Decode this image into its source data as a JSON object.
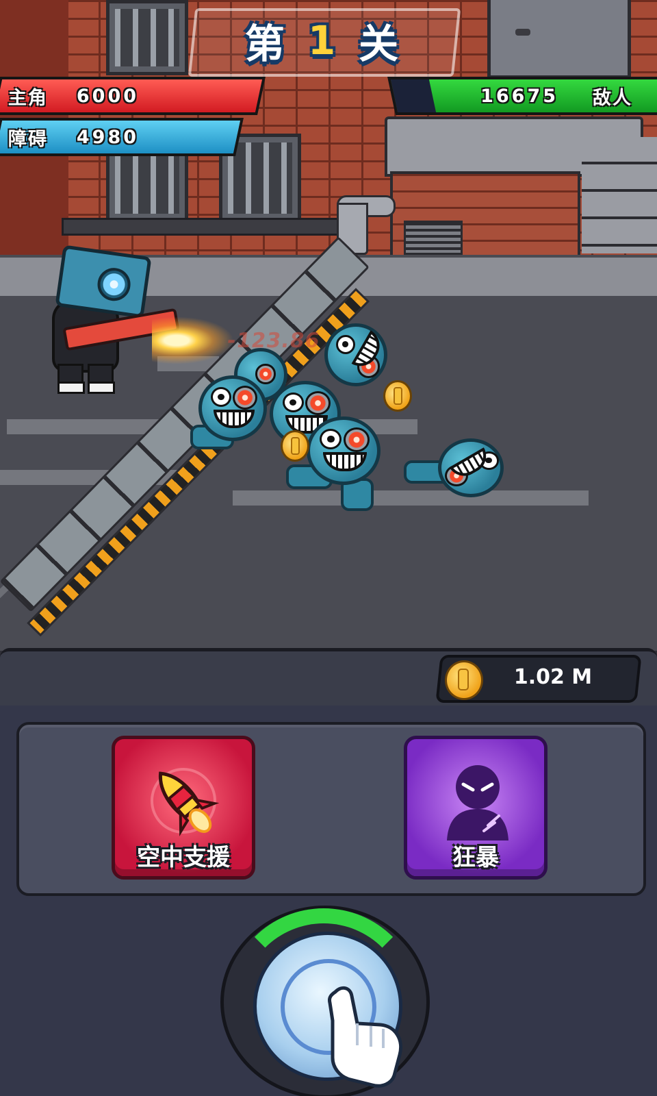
{
  "hud": {
    "level_prefix": "第",
    "level_number": "1",
    "level_suffix": "关",
    "player_bar": {
      "label": "主角",
      "value": "6000",
      "color": "#e2232b"
    },
    "obstacle_bar": {
      "label": "障碍",
      "value": "4980",
      "color": "#29a3d6"
    },
    "enemy_bar": {
      "label": "敌人",
      "value": "16675",
      "color": "#1fb52c"
    }
  },
  "battle": {
    "floating_damage": "-123.86"
  },
  "currency": {
    "icon": "gold-coin-icon",
    "amount": "1.02 M"
  },
  "skills": [
    {
      "label": "空中支援",
      "icon": "rocket-icon",
      "color": "#d61d44"
    },
    {
      "label": "狂暴",
      "icon": "rage-silhouette-icon",
      "color": "#8f3fd6"
    }
  ],
  "tap_button": {
    "icon": "tap-hand-icon",
    "charge_color": "#33d642"
  }
}
